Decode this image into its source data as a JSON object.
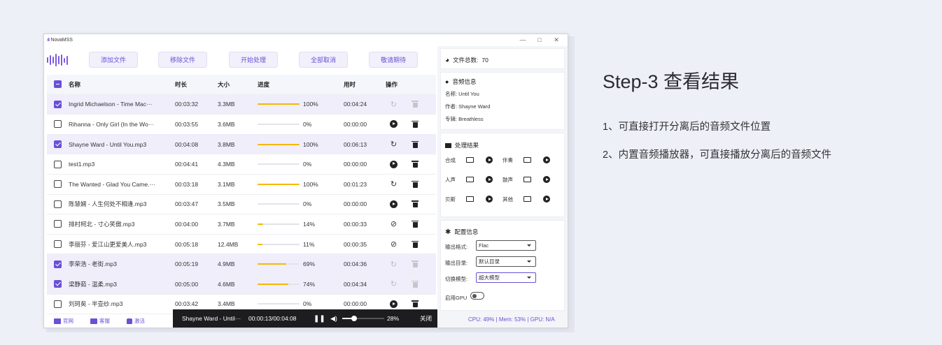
{
  "window": {
    "title": "NovaMSS",
    "minimize": "—",
    "maximize": "□",
    "close": "✕"
  },
  "toolbar": {
    "add_files": "添加文件",
    "remove_files": "移除文件",
    "start": "开始处理",
    "cancel_all": "全部取消",
    "coming_soon": "敬请期待"
  },
  "table": {
    "headers": {
      "name": "名称",
      "duration": "时长",
      "size": "大小",
      "progress": "进度",
      "elapsed": "用时",
      "actions": "操作"
    },
    "rows": [
      {
        "checked": true,
        "name": "Ingrid Michaelson - Time Mac···",
        "duration": "00:03:32",
        "size": "3.3MB",
        "progress": 1.0,
        "pct": "100%",
        "elapsed": "00:04:24",
        "action": "reload-disabled-icon",
        "delete_disabled": true
      },
      {
        "checked": false,
        "name": "Rihanna - Only Girl (In the Wo···",
        "duration": "00:03:55",
        "size": "3.6MB",
        "progress": 0.0,
        "pct": "0%",
        "elapsed": "00:00:00",
        "action": "play-icon",
        "delete_disabled": false
      },
      {
        "checked": true,
        "name": "Shayne Ward - Until You.mp3",
        "duration": "00:04:08",
        "size": "3.8MB",
        "progress": 1.0,
        "pct": "100%",
        "elapsed": "00:06:13",
        "action": "reload-icon",
        "delete_disabled": false
      },
      {
        "checked": false,
        "name": "test1.mp3",
        "duration": "00:04:41",
        "size": "4.3MB",
        "progress": 0.0,
        "pct": "0%",
        "elapsed": "00:00:00",
        "action": "play-icon",
        "delete_disabled": false
      },
      {
        "checked": false,
        "name": "The Wanted - Glad You Came.···",
        "duration": "00:03:18",
        "size": "3.1MB",
        "progress": 1.0,
        "pct": "100%",
        "elapsed": "00:01:23",
        "action": "reload-icon",
        "delete_disabled": false
      },
      {
        "checked": false,
        "name": "陈慧娴 - 人生何处不相逢.mp3",
        "duration": "00:03:47",
        "size": "3.5MB",
        "progress": 0.0,
        "pct": "0%",
        "elapsed": "00:00:00",
        "action": "play-icon",
        "delete_disabled": false
      },
      {
        "checked": false,
        "name": "排村柯北 - 寸心笑傲.mp3",
        "duration": "00:04:00",
        "size": "3.7MB",
        "progress": 0.14,
        "pct": "14%",
        "elapsed": "00:00:33",
        "action": "cancel-icon",
        "delete_disabled": false
      },
      {
        "checked": false,
        "name": "李丽芬 - 爱江山更爱美人.mp3",
        "duration": "00:05:18",
        "size": "12.4MB",
        "progress": 0.11,
        "pct": "11%",
        "elapsed": "00:00:35",
        "action": "cancel-icon",
        "delete_disabled": false
      },
      {
        "checked": true,
        "name": "李荣浩 - 老街.mp3",
        "duration": "00:05:19",
        "size": "4.9MB",
        "progress": 0.69,
        "pct": "69%",
        "elapsed": "00:04:36",
        "action": "reload-disabled-icon",
        "delete_disabled": true
      },
      {
        "checked": true,
        "name": "梁静茹 - 温柔.mp3",
        "duration": "00:05:00",
        "size": "4.6MB",
        "progress": 0.74,
        "pct": "74%",
        "elapsed": "00:04:34",
        "action": "reload-disabled-icon",
        "delete_disabled": true
      },
      {
        "checked": false,
        "name": "刘珂矣 - 半壶纱.mp3",
        "duration": "00:03:42",
        "size": "3.4MB",
        "progress": 0.0,
        "pct": "0%",
        "elapsed": "00:00:00",
        "action": "play-icon",
        "delete_disabled": false
      }
    ]
  },
  "footer": {
    "website": "官网",
    "support": "客服",
    "activate": "激活"
  },
  "player": {
    "track": "Shayne Ward - Until···",
    "time": "00:00:13/00:04:08",
    "volume": "28%",
    "volume_level": 0.28,
    "close": "关闭"
  },
  "right": {
    "file_count_label": "文件总数:",
    "file_count": "70",
    "audio_info_title": "音频信息",
    "audio_name": "名称: Until You",
    "audio_author": "作者: Shayne Ward",
    "audio_album": "专辑: Breathless",
    "result_title": "处理结果",
    "results": [
      "合成",
      "伴奏",
      "人声",
      "鼓声",
      "贝斯",
      "其他"
    ],
    "config_title": "配置信息",
    "output_format_label": "输出格式:",
    "output_format_value": "Flac",
    "output_dir_label": "输出目录:",
    "output_dir_value": "默认目录",
    "model_label": "切换模型:",
    "model_value": "超大模型",
    "gpu_label": "启用GPU",
    "status": "CPU: 49% | Mem: 53% | GPU: N/A"
  },
  "slide": {
    "title": "Step-3 查看结果",
    "line1": "1、可直接打开分离后的音频文件位置",
    "line2": "2、内置音频播放器，可直接播放分离后的音频文件"
  },
  "colors": {
    "accent": "#6a4fd8",
    "progress": "#f5b800"
  }
}
